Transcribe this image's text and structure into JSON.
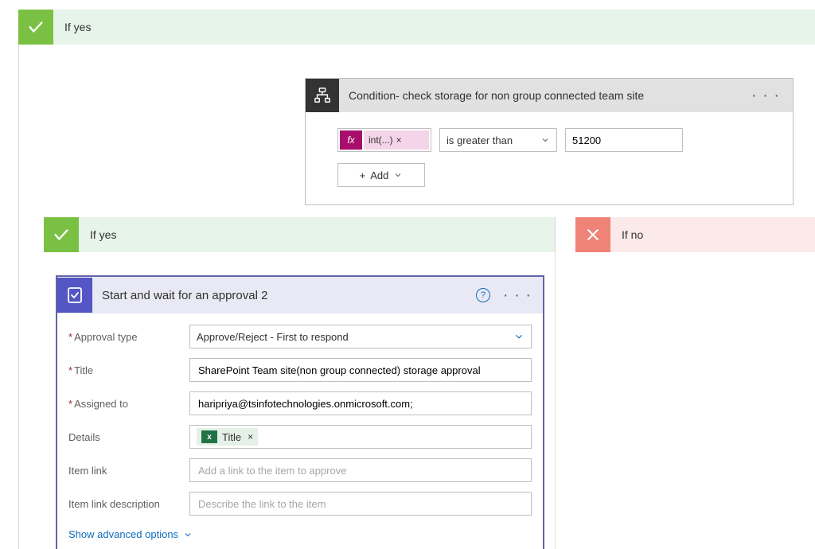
{
  "outer_if_yes": {
    "label": "If yes"
  },
  "condition": {
    "title": "Condition- check storage for non group connected team site",
    "expression": {
      "fx_label": "fx",
      "display": "int(...)",
      "remove": "×"
    },
    "operator": "is greater than",
    "value": "51200",
    "add_button": "Add"
  },
  "nested": {
    "yes_label": "If yes",
    "no_label": "If no"
  },
  "approval": {
    "title": "Start and wait for an approval 2",
    "fields": {
      "approval_type": {
        "label": "Approval type",
        "value": "Approve/Reject - First to respond"
      },
      "title": {
        "label": "Title",
        "value": "SharePoint Team site(non group connected) storage approval"
      },
      "assigned_to": {
        "label": "Assigned to",
        "value": "haripriya@tsinfotechnologies.onmicrosoft.com;"
      },
      "details": {
        "label": "Details",
        "token": "Title",
        "token_remove": "×"
      },
      "item_link": {
        "label": "Item link",
        "placeholder": "Add a link to the item to approve"
      },
      "item_link_desc": {
        "label": "Item link description",
        "placeholder": "Describe the link to the item"
      }
    },
    "advanced_label": "Show advanced options"
  },
  "icons": {
    "plus": "+",
    "help": "?",
    "more": "· · ·",
    "excel_badge": "x"
  }
}
